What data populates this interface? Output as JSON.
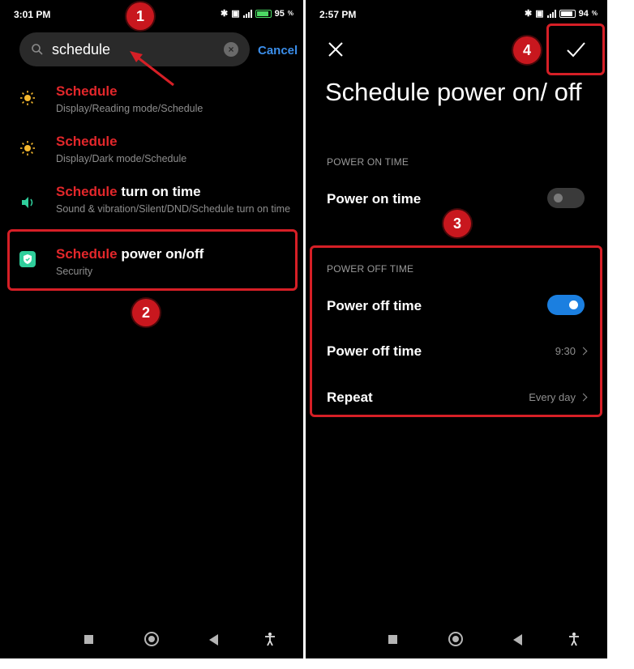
{
  "left_screen": {
    "status": {
      "time": "3:01 PM",
      "battery": "95"
    },
    "search": {
      "value": "schedule",
      "cancel_label": "Cancel"
    },
    "results": [
      {
        "highlight": "Schedule",
        "rest": "",
        "path": "Display/Reading mode/Schedule",
        "icon": "sun-icon"
      },
      {
        "highlight": "Schedule",
        "rest": "",
        "path": "Display/Dark mode/Schedule",
        "icon": "sun-icon"
      },
      {
        "highlight": "Schedule",
        "rest": " turn on time",
        "path": "Sound & vibration/Silent/DND/Schedule turn on time",
        "icon": "speaker-icon"
      },
      {
        "highlight": "Schedule",
        "rest": " power on/off",
        "path": "Security",
        "icon": "shield-icon"
      }
    ]
  },
  "right_screen": {
    "status": {
      "time": "2:57 PM",
      "battery": "94"
    },
    "title": "Schedule power on/ off",
    "power_on_section": "POWER ON TIME",
    "power_on_label": "Power on time",
    "power_on_enabled": false,
    "power_off_section": "POWER OFF TIME",
    "power_off_toggle_label": "Power off time",
    "power_off_enabled": true,
    "power_off_time_label": "Power off time",
    "power_off_time_value": "9:30",
    "repeat_label": "Repeat",
    "repeat_value": "Every day"
  },
  "annotations": {
    "step1": "1",
    "step2": "2",
    "step3": "3",
    "step4": "4"
  },
  "colors": {
    "highlight": "#e3272b",
    "accent": "#1b7fe0",
    "annotation": "#d61f26",
    "link": "#3b8eea"
  }
}
